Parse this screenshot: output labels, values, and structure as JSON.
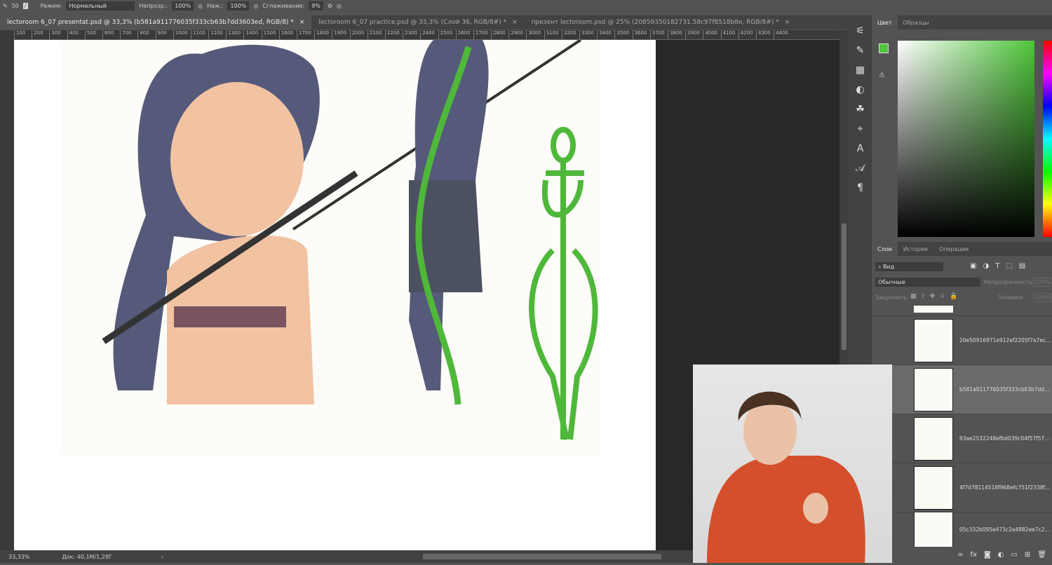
{
  "options_bar": {
    "brush_size": "50",
    "mode_label": "Режим:",
    "mode_value": "Нормальный",
    "opacity_label": "Непрозр.:",
    "opacity_value": "100%",
    "flow_label": "Наж.:",
    "flow_value": "100%",
    "smoothing_label": "Сглаживание:",
    "smoothing_value": "9%"
  },
  "tabs": [
    {
      "label": "lectoroom 6_07 presentat.psd @ 33,3% (b581a911776035f333cb63b7dd3603ed, RGB/8) *",
      "close": "×"
    },
    {
      "label": "lectoroom 6_07 practice.psd @ 33,3% (Слой 36, RGB/8#) *",
      "close": "×"
    },
    {
      "label": "презент lectoroom.psd @ 25% (20859350182731.58c97f8518b8e, RGB/8#) *",
      "close": "×"
    }
  ],
  "ruler": [
    "100",
    "200",
    "300",
    "400",
    "500",
    "600",
    "700",
    "800",
    "900",
    "1000",
    "1100",
    "1200",
    "1300",
    "1400",
    "1500",
    "1600",
    "1700",
    "1800",
    "1900",
    "2000",
    "2100",
    "2200",
    "2300",
    "2400",
    "2500",
    "2600",
    "2700",
    "2800",
    "2900",
    "3000",
    "3100",
    "3200",
    "3300",
    "3400",
    "3500",
    "3600",
    "3700",
    "3800",
    "3900",
    "4000",
    "4100",
    "4200",
    "4300",
    "4400"
  ],
  "status": {
    "zoom": "33,33%",
    "doc": "Док: 40,1M/1,28Г",
    "arrow": "›"
  },
  "color_panel": {
    "tabs": [
      "Цвет",
      "Образцы"
    ],
    "foreground": "#4ec53a"
  },
  "layers_panel": {
    "tabs": [
      "Слои",
      "История",
      "Операции"
    ],
    "filter": "Вид",
    "blend": "Обычные",
    "opacity_label": "Непрозрачность:",
    "opacity_value": "100%",
    "lock_label": "Закрепить:",
    "fill_label": "Заливка:",
    "fill_value": "100%",
    "layers": [
      {
        "name": "20e50916971e912af2205f7a7ec..."
      },
      {
        "name": "b581a911776035f333cb63b7dd..."
      },
      {
        "name": "93ae2532248efbd039c04f57f57..."
      },
      {
        "name": "4f7d78114518f968efc751f2338f..."
      },
      {
        "name": "05c332b095e473c2a4882ee7c2..."
      }
    ],
    "footer_icons": [
      "link",
      "fx",
      "mask",
      "adjustment",
      "group",
      "new-layer",
      "trash"
    ]
  }
}
